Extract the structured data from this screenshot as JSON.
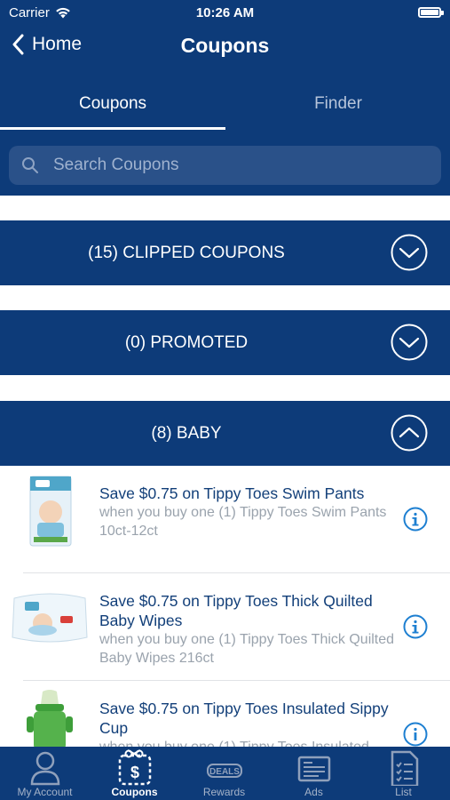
{
  "status_bar": {
    "carrier": "Carrier",
    "time": "10:26 AM"
  },
  "nav": {
    "back_label": "Home",
    "title": "Coupons"
  },
  "tabs": [
    {
      "label": "Coupons",
      "active": true
    },
    {
      "label": "Finder",
      "active": false
    }
  ],
  "search": {
    "placeholder": "Search Coupons",
    "value": ""
  },
  "sections": [
    {
      "label": "(15) CLIPPED COUPONS",
      "expanded": false
    },
    {
      "label": "(0) PROMOTED",
      "expanded": false
    },
    {
      "label": "(8) BABY",
      "expanded": true
    }
  ],
  "coupons": [
    {
      "title": "Save $0.75 on Tippy Toes Swim Pants",
      "description": "when you buy one (1) Tippy Toes Swim Pants 10ct-12ct"
    },
    {
      "title": "Save $0.75 on Tippy Toes Thick Quilted Baby Wipes",
      "description": "when you buy one (1) Tippy Toes Thick Quilted Baby Wipes 216ct"
    },
    {
      "title": "Save $0.75 on Tippy Toes Insulated Sippy Cup",
      "description": "when you buy one (1) Tippy Toes Insulated"
    }
  ],
  "tab_bar": [
    {
      "label": "My Account",
      "icon": "account-icon",
      "active": false
    },
    {
      "label": "Coupons",
      "icon": "scissors-coupon-icon",
      "active": true
    },
    {
      "label": "Rewards",
      "icon": "rewards-icon",
      "active": false,
      "icon_text": "DEALS"
    },
    {
      "label": "Ads",
      "icon": "ads-icon",
      "active": false
    },
    {
      "label": "List",
      "icon": "list-icon",
      "active": false
    }
  ],
  "colors": {
    "navy": "#0d3b79",
    "title_blue": "#123f79",
    "info_blue": "#1d7fd1",
    "muted_gray": "#9aa3ad"
  }
}
